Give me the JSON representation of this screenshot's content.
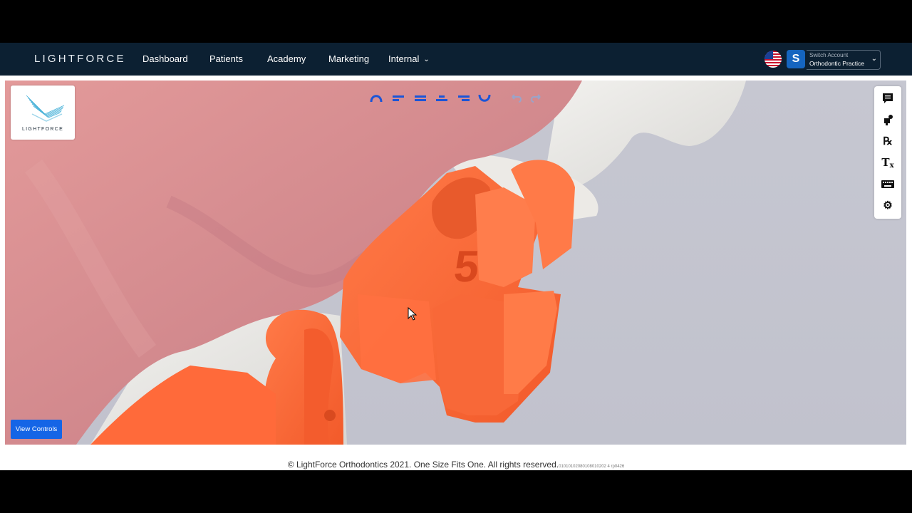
{
  "nav": {
    "brand": "LIGHTFORCE",
    "items": [
      "Dashboard",
      "Patients",
      "Academy",
      "Marketing",
      "Internal"
    ],
    "internal_chevron": "chevron-down-icon",
    "account": {
      "initial": "S",
      "switch_label": "Switch Account",
      "practice": "Orthodontic Practice",
      "chevron": "chevron-down-icon"
    }
  },
  "viewer": {
    "logo_text": "LIGHTFORCE",
    "view_controls_label": "View Controls",
    "bracket_number": "5",
    "toolbar_icons": [
      "arch-top-icon",
      "align-top-icon",
      "align-middle-icon",
      "align-bottom-icon",
      "align-bottom-alt-icon",
      "arch-bottom-icon",
      "undo-icon",
      "redo-icon"
    ],
    "right_icons": [
      "comment-icon",
      "paint-icon",
      "rx-icon",
      "tx-icon",
      "keyboard-icon",
      "settings-icon"
    ]
  },
  "footer": {
    "text": "© LightForce Orthodontics 2021. One Size Fits One. All rights reserved.",
    "small": "01010102080108010202 4 rp0426"
  },
  "colors": {
    "nav_bg": "#0c2032",
    "bracket": "#ff6a3c",
    "gum": "#d98a8e",
    "accent": "#1565e6"
  }
}
